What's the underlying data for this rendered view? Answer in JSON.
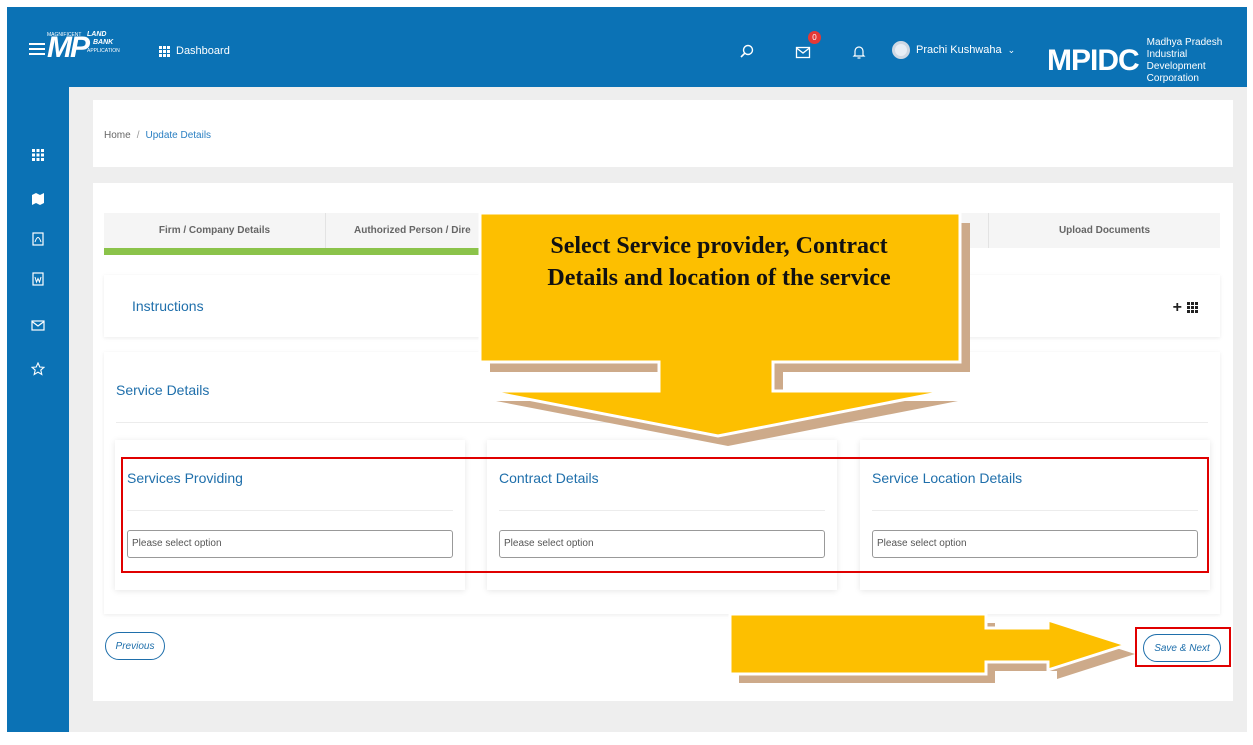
{
  "header": {
    "app_logo": "MP",
    "app_logo_tag_top": "MAGNIFICENT",
    "app_logo_tag_main1": "LAND",
    "app_logo_tag_main2": "BANK",
    "app_logo_tag_bottom": "APPLICATION",
    "nav_label": "Dashboard",
    "mail_badge": "0",
    "user_name": "Prachi Kushwaha",
    "org_logo": "MPIDC",
    "org_name_line1": "Madhya Pradesh Industrial",
    "org_name_line2": "Development Corporation"
  },
  "sidebar": {
    "icons": [
      "grid-icon",
      "map-icon",
      "pdf-icon",
      "word-doc-icon",
      "mail-icon",
      "star-icon"
    ]
  },
  "breadcrumb": {
    "home": "Home",
    "current": "Update Details"
  },
  "tabs": [
    {
      "label": "Firm / Company Details"
    },
    {
      "label": "Authorized Person / Dire"
    },
    {
      "label": ""
    },
    {
      "label": ""
    },
    {
      "label": "Upload Documents"
    }
  ],
  "instructions": {
    "title": "Instructions",
    "plus": "+"
  },
  "service_details": {
    "title": "Service Details",
    "sections": [
      {
        "title": "Services Providing",
        "placeholder": "Please select option"
      },
      {
        "title": "Contract Details",
        "placeholder": "Please select option"
      },
      {
        "title": "Service Location Details",
        "placeholder": "Please select option"
      }
    ]
  },
  "buttons": {
    "previous": "Previous",
    "save_next": "Save & Next"
  },
  "callout": {
    "line1": "Select Service provider, Contract",
    "line2": "Details and location of the service"
  },
  "colors": {
    "header_blue": "#0b72b5",
    "link_blue": "#1f6fab",
    "progress_green": "#8bc34a",
    "annotation_yellow": "#fdbf00",
    "annotation_red": "#e00000"
  }
}
